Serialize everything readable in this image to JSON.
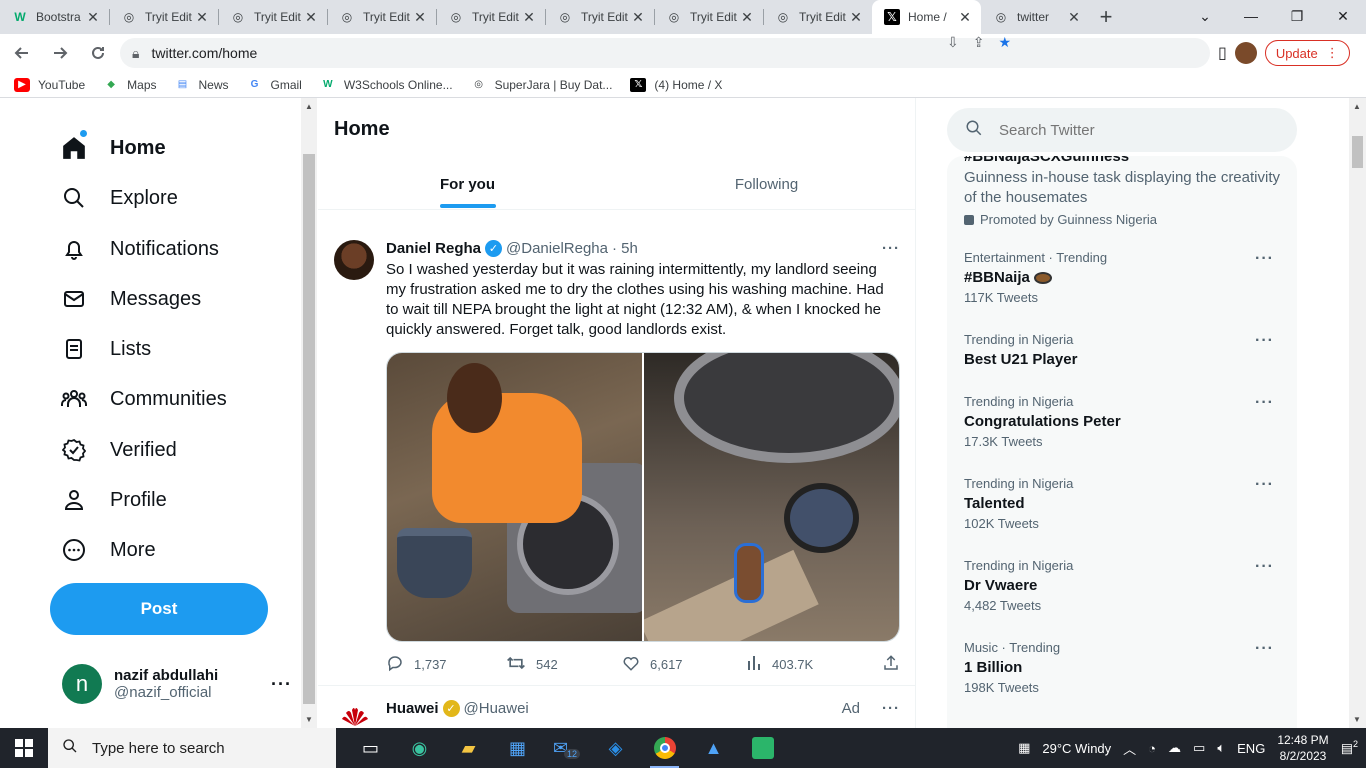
{
  "browser": {
    "tabs": [
      {
        "title": "Bootstra",
        "icon": "w3schools-icon",
        "active": false
      },
      {
        "title": "Tryit Edit",
        "icon": "globe-icon",
        "active": false
      },
      {
        "title": "Tryit Edit",
        "icon": "globe-icon",
        "active": false
      },
      {
        "title": "Tryit Edit",
        "icon": "globe-icon",
        "active": false
      },
      {
        "title": "Tryit Edit",
        "icon": "globe-icon",
        "active": false
      },
      {
        "title": "Tryit Edit",
        "icon": "globe-icon",
        "active": false
      },
      {
        "title": "Tryit Edit",
        "icon": "globe-icon",
        "active": false
      },
      {
        "title": "Tryit Edit",
        "icon": "globe-icon",
        "active": false
      },
      {
        "title": "Home /",
        "icon": "x-logo-icon",
        "active": true
      },
      {
        "title": "twitter",
        "icon": "globe-icon",
        "active": false
      }
    ],
    "url": "twitter.com/home",
    "update_label": "Update",
    "bookmarks": [
      {
        "label": "YouTube",
        "icon": "youtube-icon"
      },
      {
        "label": "Maps",
        "icon": "maps-icon"
      },
      {
        "label": "News",
        "icon": "news-icon"
      },
      {
        "label": "Gmail",
        "icon": "google-icon"
      },
      {
        "label": "W3Schools Online...",
        "icon": "w3schools-icon"
      },
      {
        "label": "SuperJara | Buy Dat...",
        "icon": "globe-icon"
      },
      {
        "label": "(4) Home / X",
        "icon": "x-logo-icon"
      }
    ]
  },
  "nav": {
    "items": [
      {
        "label": "Home",
        "icon": "home-icon"
      },
      {
        "label": "Explore",
        "icon": "search-icon"
      },
      {
        "label": "Notifications",
        "icon": "bell-icon"
      },
      {
        "label": "Messages",
        "icon": "envelope-icon"
      },
      {
        "label": "Lists",
        "icon": "list-icon"
      },
      {
        "label": "Communities",
        "icon": "communities-icon"
      },
      {
        "label": "Verified",
        "icon": "verified-badge-icon"
      },
      {
        "label": "Profile",
        "icon": "person-icon"
      },
      {
        "label": "More",
        "icon": "more-circle-icon"
      }
    ],
    "post_label": "Post",
    "account": {
      "name": "nazif abdullahi",
      "handle": "@nazif_official",
      "initial": "n"
    }
  },
  "timeline": {
    "title": "Home",
    "tabs": [
      "For you",
      "Following"
    ],
    "tweet": {
      "name": "Daniel Regha",
      "handle": "@DanielRegha",
      "time": "· 5h",
      "text": "So I washed yesterday but it was raining intermittently, my landlord seeing my frustration asked me to dry the clothes using his washing machine. Had to wait till NEPA brought the light at night (12:32 AM), & when I knocked he quickly answered. Forget talk, good landlords exist.",
      "replies": "1,737",
      "retweets": "542",
      "likes": "6,617",
      "views": "403.7K"
    },
    "ad": {
      "name": "Huawei",
      "handle": "@Huawei",
      "label": "Ad"
    }
  },
  "sidebar": {
    "search_placeholder": "Search Twitter",
    "promo": {
      "tag": "#BBNaijaSCXGuinness",
      "desc": "Guinness in-house task displaying the creativity of the housemates",
      "by": "Promoted by Guinness Nigeria"
    },
    "trends": [
      {
        "meta": "Entertainment · Trending",
        "name": "#BBNaija",
        "count": "117K Tweets"
      },
      {
        "meta": "Trending in Nigeria",
        "name": "Best U21 Player",
        "count": ""
      },
      {
        "meta": "Trending in Nigeria",
        "name": "Congratulations Peter",
        "count": "17.3K Tweets"
      },
      {
        "meta": "Trending in Nigeria",
        "name": "Talented",
        "count": "102K Tweets"
      },
      {
        "meta": "Trending in Nigeria",
        "name": "Dr Vwaere",
        "count": "4,482 Tweets"
      },
      {
        "meta": "Music · Trending",
        "name": "1 Billion",
        "count": "198K Tweets"
      }
    ]
  },
  "taskbar": {
    "search_placeholder": "Type here to search",
    "mail_badge": "12",
    "weather": "29°C  Windy",
    "lang": "ENG",
    "time": "12:48 PM",
    "date": "8/2/2023",
    "notif_count": "2"
  },
  "colors": {
    "accent": "#1d9bf0",
    "text": "#0f1419",
    "muted": "#536471"
  }
}
